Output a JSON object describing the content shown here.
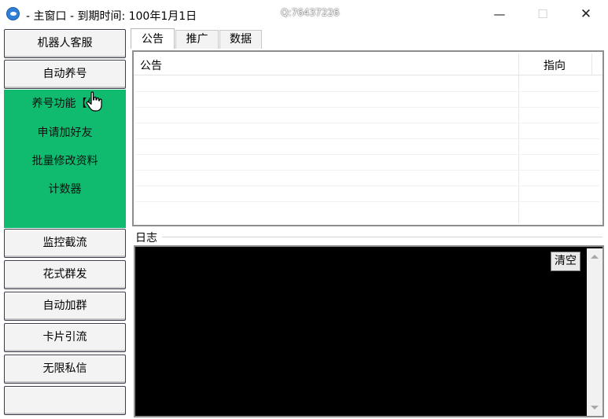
{
  "window": {
    "title": "- 主窗口 -  到期时间: 100年1月1日",
    "watermark": "Q:76437226",
    "minimize": "—",
    "maximize": "☐",
    "close": "✕"
  },
  "sidebar": {
    "top_buttons": [
      "机器人客服",
      "自动养号"
    ],
    "submenu": [
      "养号功能【偷",
      "申请加好友",
      "批量修改资料",
      "计数器"
    ],
    "bottom_buttons": [
      "监控截流",
      "花式群发",
      "自动加群",
      "卡片引流",
      "无限私信",
      ""
    ]
  },
  "tabs": [
    "公告",
    "推广",
    "数据"
  ],
  "notice_table": {
    "columns": [
      "公告",
      "指向"
    ]
  },
  "log": {
    "label": "日志",
    "clear_button": "清空"
  }
}
